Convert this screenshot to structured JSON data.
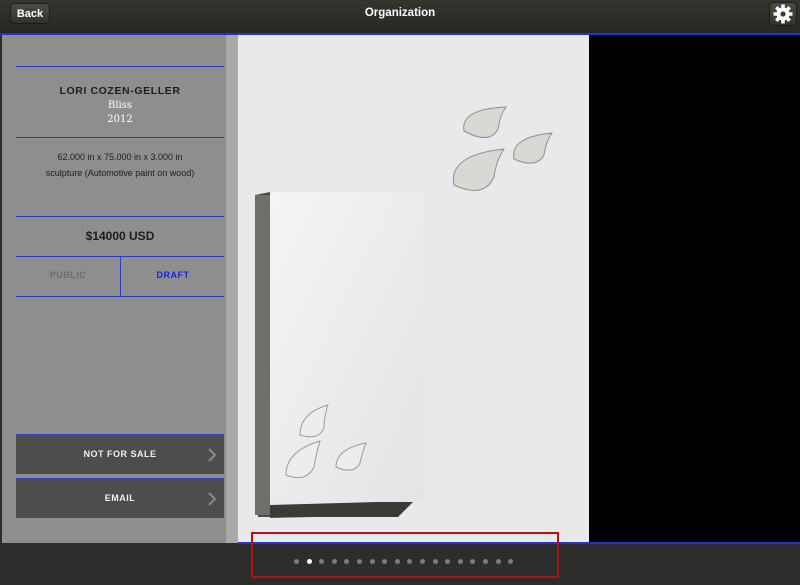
{
  "header": {
    "back_label": "Back",
    "title": "Organization",
    "settings_icon": "gear-icon"
  },
  "artwork": {
    "artist": "LORI COZEN-GELLER",
    "title": "Bliss",
    "year": "2012",
    "dimensions": "62.000 in x 75.000 in x 3.000 in",
    "medium": "sculpture (Automotive paint on wood)",
    "price": "$14000 USD"
  },
  "visibility": {
    "options": [
      "PUBLIC",
      "DRAFT"
    ],
    "selected": "DRAFT"
  },
  "actions": [
    {
      "label": "NOT FOR SALE",
      "icon": "chevron-right-icon"
    },
    {
      "label": "EMAIL",
      "icon": "chevron-right-icon"
    }
  ],
  "pagination": {
    "total": 18,
    "current": 2
  },
  "colors": {
    "accent": "#2231d8",
    "highlight": "#b01316",
    "draft": "#1b25d6"
  }
}
